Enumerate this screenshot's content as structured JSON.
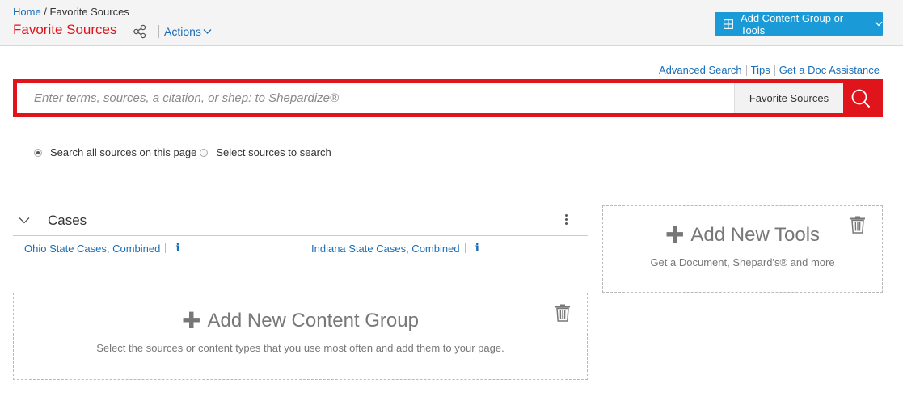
{
  "header": {
    "breadcrumb_home": "Home",
    "breadcrumb_sep": " / ",
    "breadcrumb_current": "Favorite Sources",
    "title": "Favorite Sources",
    "actions_label": "Actions",
    "add_button_label": "Add Content Group or Tools"
  },
  "top_links": {
    "advanced_search": "Advanced Search",
    "tips": "Tips",
    "get_doc": "Get a Doc Assistance"
  },
  "search": {
    "placeholder": "Enter terms, sources, a citation, or shep: to Shepardize®",
    "scope": "Favorite Sources"
  },
  "radios": {
    "option_all": "Search all sources on this page",
    "option_select": "Select sources to search",
    "selected": "option_all"
  },
  "cases_panel": {
    "title": "Cases",
    "sources": [
      {
        "label": "Ohio State Cases, Combined",
        "info": "i"
      },
      {
        "label": "Indiana State Cases, Combined",
        "info": "i"
      }
    ]
  },
  "tools_box": {
    "title": "Add New Tools",
    "subtitle": "Get a Document, Shepard's® and more"
  },
  "content_box": {
    "title": "Add New Content Group",
    "subtitle": "Select the sources or content types that you use most often and add them to your page."
  },
  "colors": {
    "accent_red": "#e0151b",
    "link_blue": "#1a6eb7",
    "button_blue": "#1a9ad6"
  }
}
